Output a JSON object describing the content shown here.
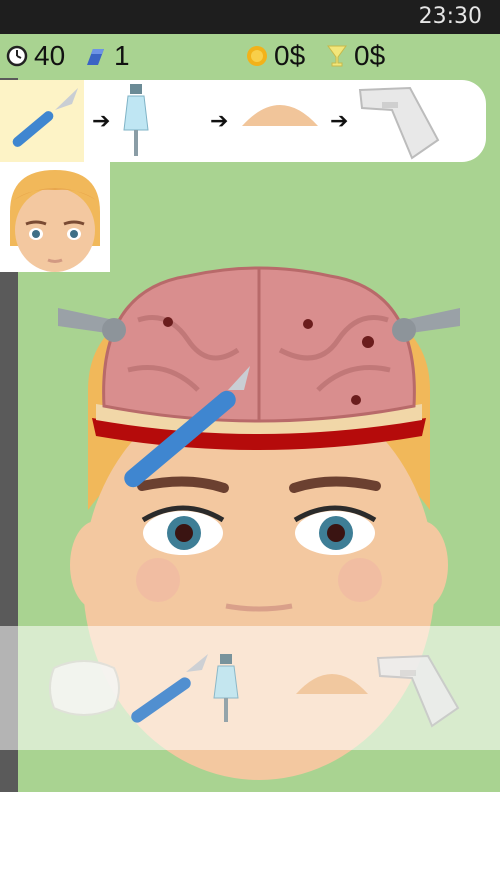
{
  "status_bar": {
    "time": "23:30"
  },
  "hud": {
    "timer": {
      "icon": "clock-icon",
      "value": "40"
    },
    "level": {
      "icon": "bandage-icon",
      "value": "1"
    },
    "money": {
      "icon": "coin-icon",
      "value": "0$"
    },
    "reward": {
      "icon": "trophy-icon",
      "value": "0$"
    }
  },
  "steps": [
    {
      "icon": "scalpel-icon",
      "active": true
    },
    {
      "icon": "iv-drip-icon"
    },
    {
      "icon": "skull-cap-icon"
    },
    {
      "icon": "stapler-icon"
    }
  ],
  "tray": [
    "gauze-icon",
    "scalpel-icon",
    "iv-drip-icon",
    "skull-cap-icon",
    "stapler-icon"
  ],
  "colors": {
    "board": "#a9d391",
    "skin": "#f3c8a0",
    "hair": "#f1b85a",
    "brain": "#d98e8e",
    "accent_blue": "#3f86d0"
  }
}
